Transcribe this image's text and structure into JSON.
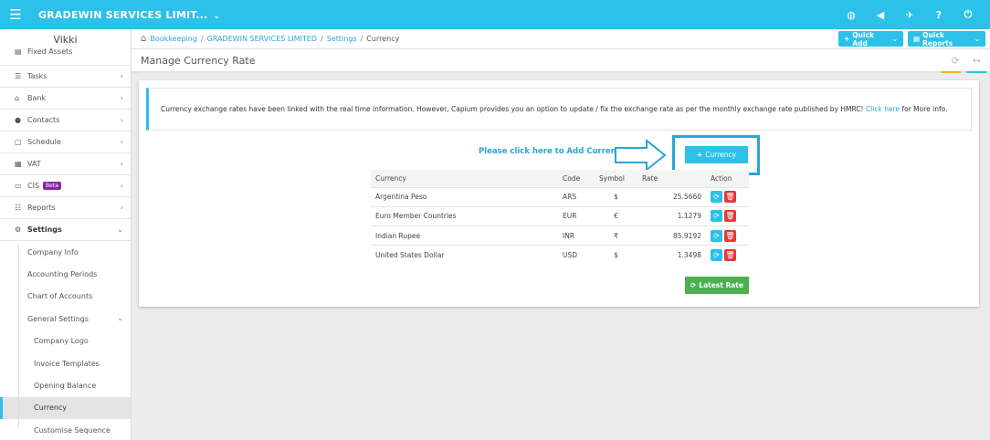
{
  "topbar": {
    "company": "GRADEWIN SERVICES LIMIT...",
    "icons": [
      "globe-icon",
      "megaphone-icon",
      "rocket-icon",
      "help-icon",
      "power-icon"
    ],
    "help_label": "?"
  },
  "sidebar": {
    "user": "Vikki",
    "items": [
      {
        "label": "Fixed Assets",
        "icon": "book-icon"
      },
      {
        "label": "Tasks",
        "icon": "tasks-icon"
      },
      {
        "label": "Bank",
        "icon": "bank-icon"
      },
      {
        "label": "Contacts",
        "icon": "contacts-icon"
      },
      {
        "label": "Schedule",
        "icon": "calendar-icon"
      },
      {
        "label": "VAT",
        "icon": "calculator-icon"
      },
      {
        "label": "CIS",
        "icon": "card-icon",
        "badge": "Beta"
      },
      {
        "label": "Reports",
        "icon": "list-icon"
      },
      {
        "label": "Settings",
        "icon": "cogs-icon"
      }
    ],
    "settings_sub": [
      "Company Info",
      "Accounting Periods",
      "Chart of Accounts",
      "General Settings"
    ],
    "general_sub": [
      "Company Logo",
      "Invoice Templates",
      "Opening Balance",
      "Currency",
      "Customise Sequence"
    ]
  },
  "breadcrumb": {
    "items": [
      "Bookkeeping",
      "GRADEWIN SERVICES LIMITED",
      "Settings"
    ],
    "current": "Currency",
    "separator": "/"
  },
  "header_buttons": {
    "quick_add": "Quick Add",
    "quick_reports": "Quick Reports"
  },
  "page": {
    "title": "Manage Currency Rate"
  },
  "info": {
    "text": "Currency exchange rates have been linked with the real time information. However, Capium provides you an option to update / fix the exchange rate as per the monthly exchange rate published by HMRC!",
    "link": "Click here",
    "suffix": "for More info."
  },
  "hint": "Please click here to Add Currency",
  "add_button": "Currency",
  "table": {
    "headers": [
      "Currency",
      "Code",
      "Symbol",
      "Rate",
      "Action"
    ],
    "rows": [
      {
        "currency": "Argentina Peso",
        "code": "ARS",
        "symbol": "$",
        "rate": "25.5660"
      },
      {
        "currency": "Euro Member Countries",
        "code": "EUR",
        "symbol": "€",
        "rate": "1.1279"
      },
      {
        "currency": "Indian Rupee",
        "code": "INR",
        "symbol": "₹",
        "rate": "85.9192"
      },
      {
        "currency": "United States Dollar",
        "code": "USD",
        "symbol": "$",
        "rate": "1.3498"
      }
    ]
  },
  "latest_button": "Latest Rate",
  "colors": {
    "primary": "#2cc1e8",
    "link": "#2aa5d5",
    "success": "#4caf50",
    "danger": "#e53935",
    "badge": "#8e24aa",
    "accent_yellow": "#f2b12c"
  }
}
